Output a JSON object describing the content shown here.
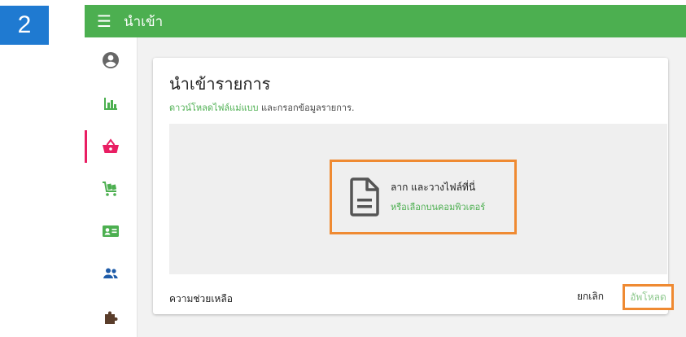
{
  "step": {
    "number": "2"
  },
  "topbar": {
    "menu_icon": "menu-icon",
    "title": "นำเข้า"
  },
  "sidebar": {
    "items": [
      {
        "name": "account-icon",
        "active": false
      },
      {
        "name": "chart-icon",
        "active": false
      },
      {
        "name": "basket-icon",
        "active": true
      },
      {
        "name": "cart-icon",
        "active": false
      },
      {
        "name": "contact-card-icon",
        "active": false
      },
      {
        "name": "people-icon",
        "active": false
      },
      {
        "name": "puzzle-icon",
        "active": false
      }
    ]
  },
  "card": {
    "title": "นำเข้ารายการ",
    "subtitle_link": "ดาวน์โหลดไฟล์แม่แบบ",
    "subtitle_rest": " และกรอกข้อมูลรายการ.",
    "dropzone": {
      "icon": "file-document-icon",
      "main_text": "ลาก และวางไฟล์ที่นี่",
      "link_text": "หรือเลือกบนคอมพิวเตอร์"
    },
    "help_label": "ความช่วยเหลือ",
    "cancel_label": "ยกเลิก",
    "upload_label": "อัพโหลด"
  },
  "colors": {
    "topbar": "#4caf50",
    "accent": "#4caf50",
    "active_indicator": "#e91e63",
    "highlight_box": "#ef8a32",
    "step_badge": "#1f7ad1"
  }
}
